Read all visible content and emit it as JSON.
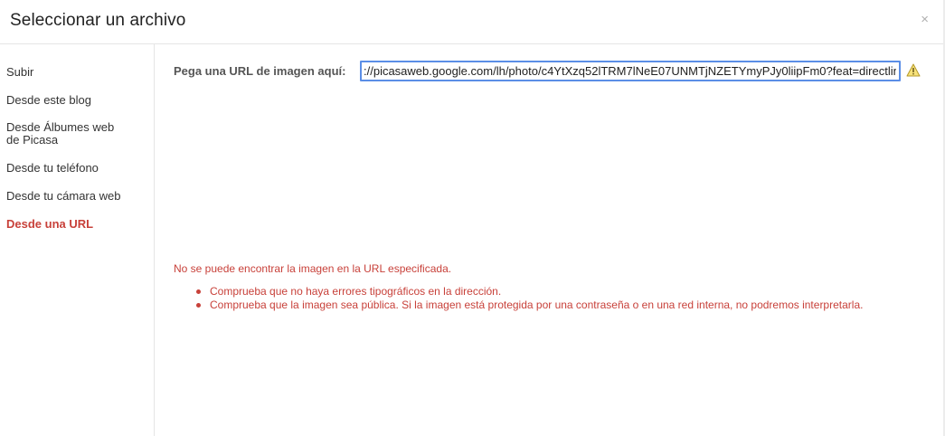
{
  "dialog": {
    "title": "Seleccionar un archivo",
    "close_label": "×"
  },
  "sidebar": {
    "items": [
      {
        "label": "Subir",
        "active": false
      },
      {
        "label": "Desde este blog",
        "active": false
      },
      {
        "label": "Desde Álbumes web de Picasa",
        "active": false
      },
      {
        "label": "Desde tu teléfono",
        "active": false
      },
      {
        "label": "Desde tu cámara web",
        "active": false
      },
      {
        "label": "Desde una URL",
        "active": true
      }
    ]
  },
  "main": {
    "url_label": "Pega una URL de imagen aquí:",
    "url_value": "://picasaweb.google.com/lh/photo/c4YtXzq52lTRM7lNeE07UNMTjNZETYmyPJy0liipFm0?feat=directlin",
    "warning_icon": "warning-triangle-icon",
    "error_message": "No se puede encontrar la imagen en la URL especificada.",
    "error_items": [
      "Comprueba que no haya errores tipográficos en la dirección.",
      "Comprueba que la imagen sea pública. Si la imagen está protegida por una contraseña o en una red interna, no podremos interpretarla."
    ]
  },
  "colors": {
    "accent_red": "#c8413a",
    "input_border": "#5b8ee6",
    "divider": "#e5e5e5"
  }
}
